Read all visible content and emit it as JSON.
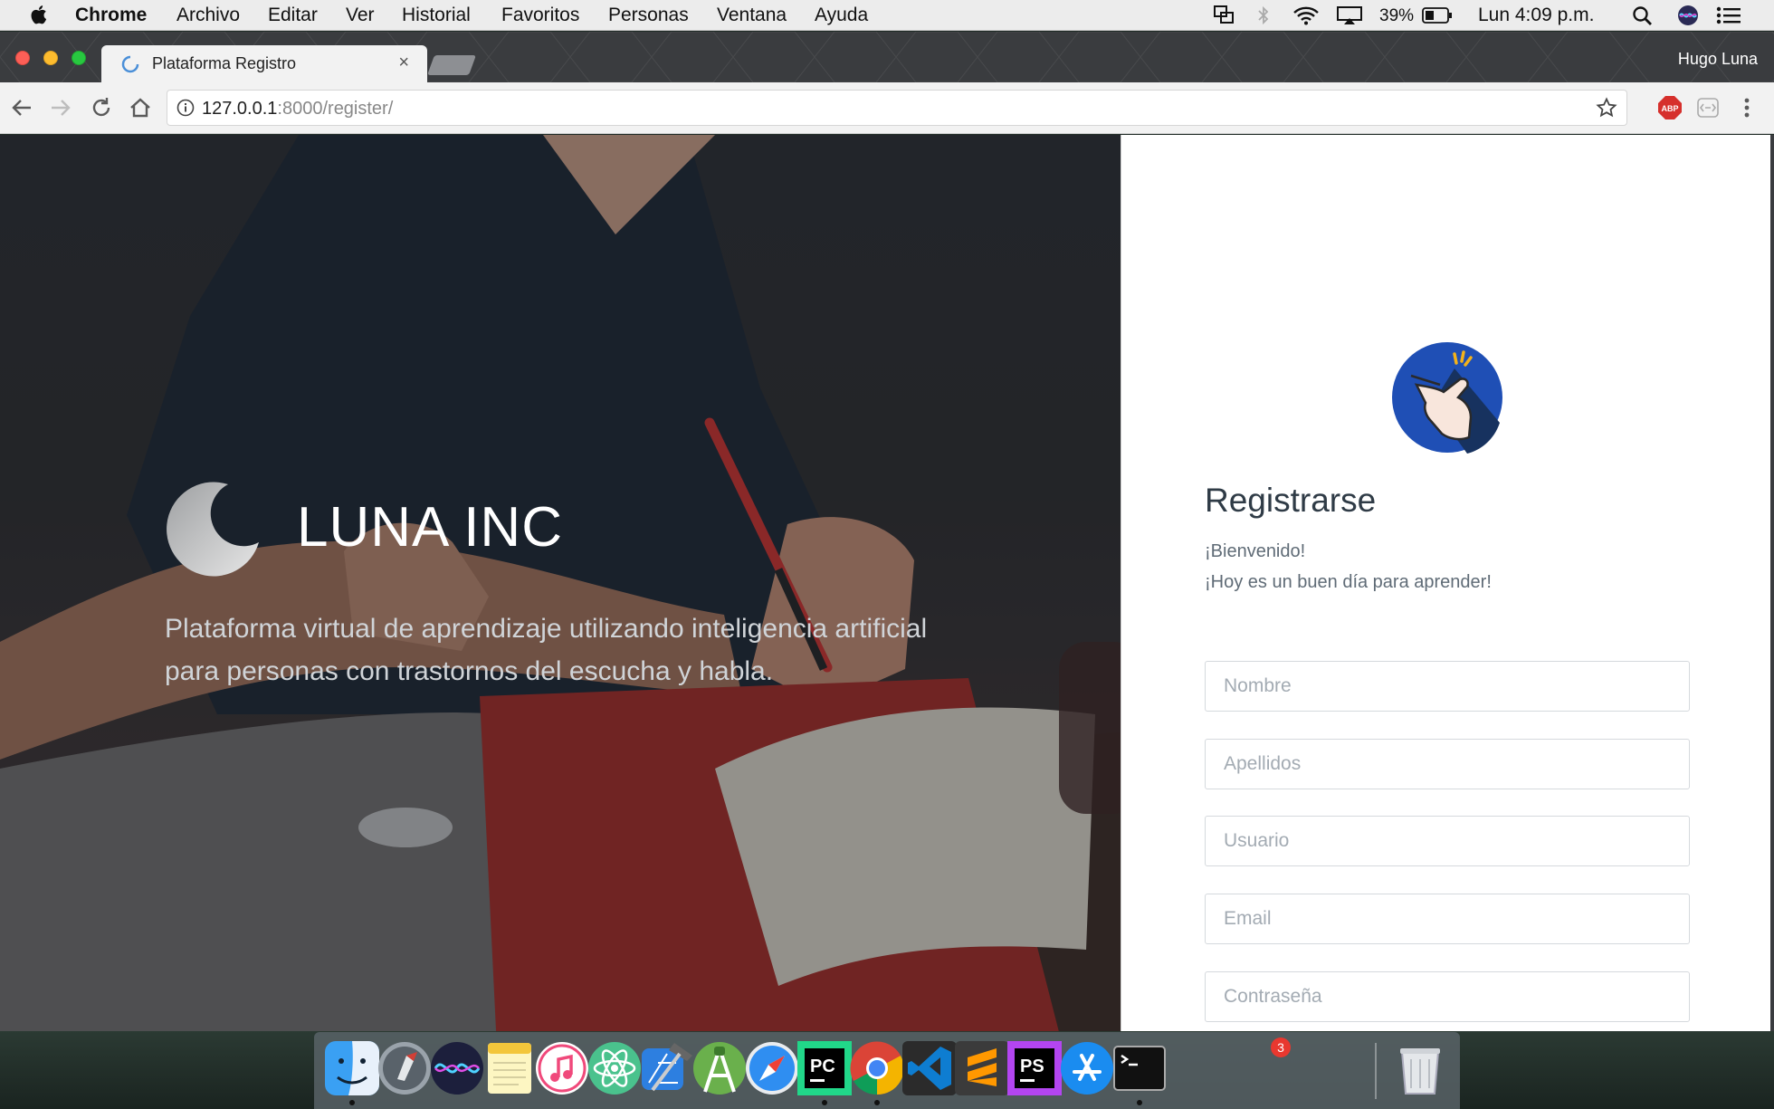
{
  "menubar": {
    "app_name": "Chrome",
    "items": [
      "Archivo",
      "Editar",
      "Ver",
      "Historial",
      "Favoritos",
      "Personas",
      "Ventana",
      "Ayuda"
    ],
    "battery_percent": "39%",
    "clock": "Lun 4:09 p.m."
  },
  "browser": {
    "tab_title": "Plataforma Registro",
    "tab_close": "×",
    "profile_name": "Hugo Luna",
    "url_host": "127.0.0.1",
    "url_rest": ":8000/register/",
    "abp_label": "ABP"
  },
  "hero": {
    "brand_name": "LUNA INC",
    "description_line1": "Plataforma virtual de aprendizaje utilizando inteligencia artificial",
    "description_line2": "para personas con trastornos del escucha y habla."
  },
  "register": {
    "title": "Registrarse",
    "welcome_line1": "¡Bienvenido!",
    "welcome_line2": "¡Hoy es un buen día para aprender!",
    "fields": {
      "nombre_placeholder": "Nombre",
      "apellidos_placeholder": "Apellidos",
      "usuario_placeholder": "Usuario",
      "email_placeholder": "Email",
      "password_placeholder": "Contraseña"
    }
  },
  "dock": {
    "apps": [
      "finder-icon",
      "launchpad-icon",
      "siri-icon",
      "notes-icon",
      "itunes-icon",
      "atom-icon",
      "xcode-icon",
      "android-studio-icon",
      "safari-icon",
      "pycharm-icon",
      "chrome-icon",
      "vscode-icon",
      "sublime-icon",
      "phpstorm-icon",
      "app-store-icon",
      "terminal-icon",
      "trash-icon"
    ],
    "app_store_badge": "3",
    "pycharm_label": "PC",
    "phpstorm_label": "PS"
  },
  "colors": {
    "panel_title": "#2f3b46",
    "avatar_bg": "#1f4fb5",
    "field_border": "#d5d9dd",
    "placeholder": "#a3abb3"
  }
}
